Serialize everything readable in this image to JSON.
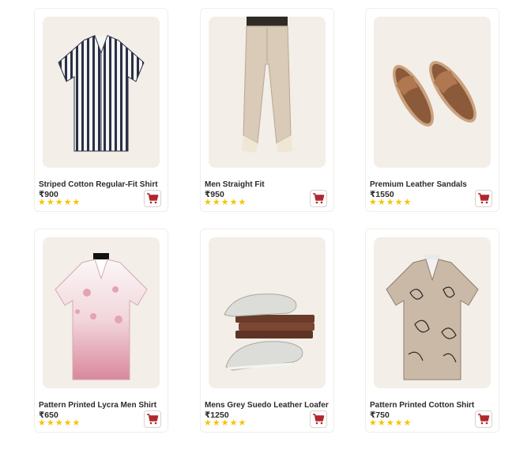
{
  "products": [
    {
      "name": "Striped Cotton Regular-Fit Shirt",
      "price": "₹900",
      "rating": 5,
      "image_icon": "striped-shirt-icon"
    },
    {
      "name": "Men Straight Fit",
      "price": "₹950",
      "rating": 5,
      "image_icon": "trousers-icon"
    },
    {
      "name": "Premium Leather Sandals",
      "price": "₹1550",
      "rating": 5,
      "image_icon": "sandals-icon"
    },
    {
      "name": "Pattern Printed Lycra Men Shirt",
      "price": "₹650",
      "rating": 5,
      "image_icon": "floral-shirt-icon"
    },
    {
      "name": "Mens Grey Suedo Leather Loafer",
      "price": "₹1250",
      "rating": 5,
      "image_icon": "loafers-icon"
    },
    {
      "name": "Pattern Printed Cotton Shirt",
      "price": "₹750",
      "rating": 5,
      "image_icon": "printed-shirt-icon"
    }
  ],
  "star_glyph": "★",
  "colors": {
    "star": "#f5c400",
    "cart": "#b0262c",
    "card_bg": "#f3eee8"
  }
}
